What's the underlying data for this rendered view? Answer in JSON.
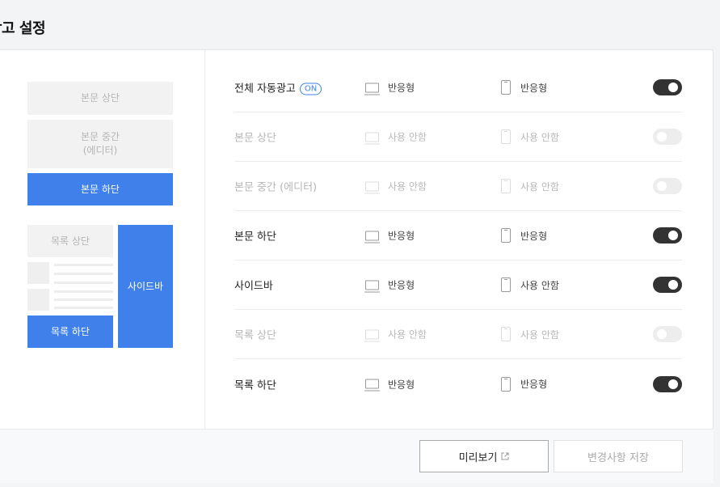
{
  "page": {
    "title": "광고 설정"
  },
  "preview": {
    "blocks": {
      "body_top": "본문 상단",
      "body_middle": "본문 중간\n(에디터)",
      "body_bottom": "본문 하단",
      "list_top": "목록 상단",
      "list_bottom": "목록 하단",
      "sidebar": "사이드바"
    }
  },
  "settings": {
    "rows": [
      {
        "label": "전체 자동광고",
        "badge": "ON",
        "pc": "반응형",
        "mobile": "반응형",
        "enabled": true
      },
      {
        "label": "본문 상단",
        "pc": "사용 안함",
        "mobile": "사용 안함",
        "enabled": false
      },
      {
        "label": "본문 중간 (에디터)",
        "pc": "사용 안함",
        "mobile": "사용 안함",
        "enabled": false
      },
      {
        "label": "본문 하단",
        "pc": "반응형",
        "mobile": "반응형",
        "enabled": true
      },
      {
        "label": "사이드바",
        "pc": "반응형",
        "mobile": "사용 안함",
        "enabled": true
      },
      {
        "label": "목록 상단",
        "pc": "사용 안함",
        "mobile": "사용 안함",
        "enabled": false
      },
      {
        "label": "목록 하단",
        "pc": "반응형",
        "mobile": "반응형",
        "enabled": true
      }
    ]
  },
  "footer": {
    "preview_label": "미리보기",
    "save_label": "변경사항 저장"
  },
  "colors": {
    "accent": "#3f80ea",
    "toggle_on": "#333333",
    "toggle_off": "#ededed"
  },
  "icons": [
    "desktop-icon",
    "mobile-icon",
    "external-link-icon"
  ]
}
